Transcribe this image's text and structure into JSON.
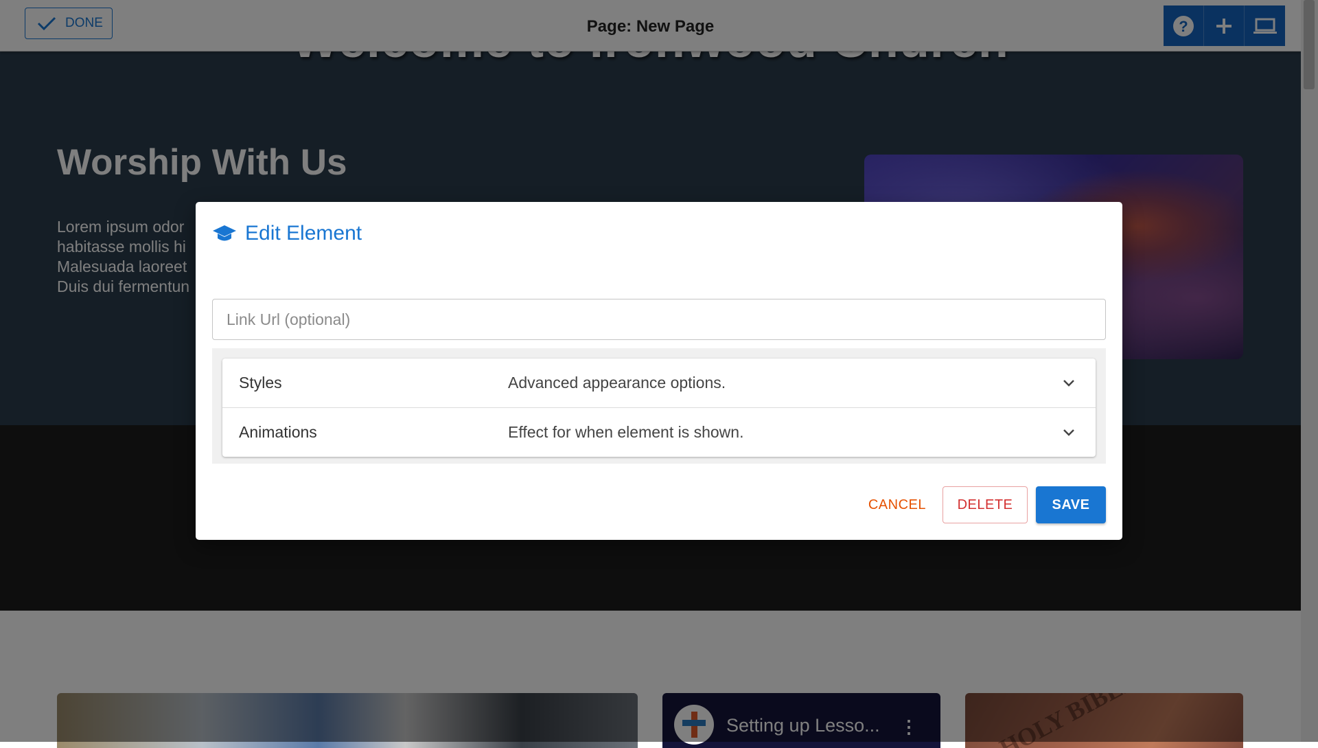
{
  "topbar": {
    "done_label": "DONE",
    "page_title": "Page: New Page",
    "tools": [
      "help-icon",
      "add-icon",
      "laptop-icon"
    ]
  },
  "hero": {
    "title": "Welcome to Ironwood Church",
    "section_title": "Worship With Us",
    "body_lines": [
      "Lorem ipsum odor",
      "habitasse mollis hi",
      "Malesuada laoreet",
      "Duis dui fermentun"
    ]
  },
  "cards": {
    "video_title": "Setting up Lesso...",
    "bible_text": "HOLY BIBLE"
  },
  "dialog": {
    "title": "Edit Element",
    "icon": "graduation-cap-icon",
    "link_placeholder": "Link Url (optional)",
    "link_value": "",
    "sections": [
      {
        "label": "Styles",
        "description": "Advanced appearance options."
      },
      {
        "label": "Animations",
        "description": "Effect for when element is shown."
      }
    ],
    "cancel_label": "CANCEL",
    "delete_label": "DELETE",
    "save_label": "SAVE"
  },
  "colors": {
    "primary": "#1976d2",
    "cancel": "#e65100",
    "delete": "#d32f2f",
    "hero_bg": "#2b3d4d"
  }
}
